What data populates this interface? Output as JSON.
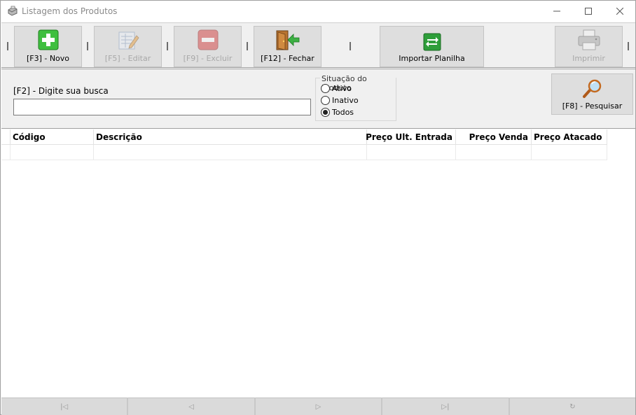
{
  "window": {
    "title": "Listagem dos Produtos",
    "controls": {
      "minimize": "—",
      "maximize": "☐",
      "close": "✕"
    }
  },
  "toolbar": {
    "buttons": [
      {
        "label": "[F3] - Novo",
        "icon": "plus-icon",
        "enabled": true
      },
      {
        "label": "[F5] - Editar",
        "icon": "edit-icon",
        "enabled": false
      },
      {
        "label": "[F9] - Excluir",
        "icon": "minus-icon",
        "enabled": false
      },
      {
        "label": "[F12] - Fechar",
        "icon": "exit-door-icon",
        "enabled": true
      },
      {
        "label": "Importar Planilha",
        "icon": "spreadsheet-import-icon",
        "enabled": true
      },
      {
        "label": "Imprimir",
        "icon": "printer-icon",
        "enabled": false
      }
    ]
  },
  "search": {
    "label": "[F2] - Digite sua busca",
    "value": "",
    "placeholder": "",
    "button_label": "[F8] - Pesquisar",
    "button_icon": "magnifier-icon"
  },
  "status_filter": {
    "title": "Situação do Produto",
    "options": [
      "Ativo",
      "Inativo",
      "Todos"
    ],
    "selected": "Todos"
  },
  "grid": {
    "columns": [
      "Código",
      "Descrição",
      "Preço Ult. Entrada",
      "Preço Venda",
      "Preço Atacado"
    ]
  },
  "navigation": {
    "first": "|◁",
    "prev": "◁",
    "next": "▷",
    "last": "▷|",
    "refresh": "↻"
  },
  "colors": {
    "window_bg": "#ffffff",
    "panel_bg": "#f0f0f0",
    "button_bg": "#dedede",
    "disabled_text": "#a8a8a8",
    "plus_green": "#3fbf3f",
    "minus_red": "#d85050"
  }
}
